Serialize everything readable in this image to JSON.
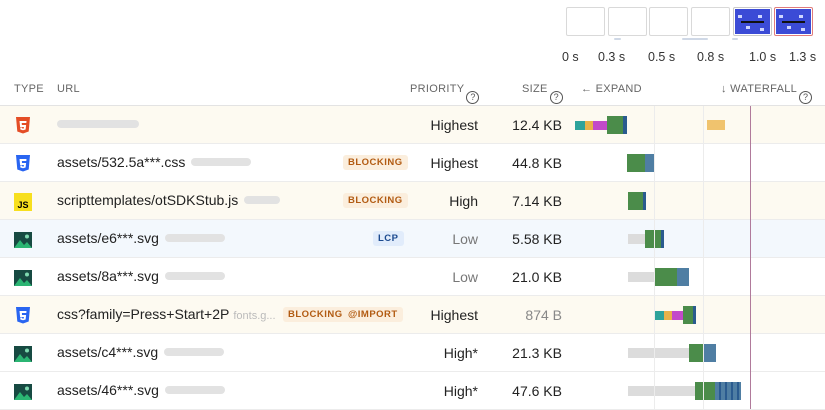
{
  "filmstrip": {
    "times": [
      "0 s",
      "0.3 s",
      "0.5 s",
      "0.8 s",
      "1.0 s",
      "1.3 s"
    ]
  },
  "header": {
    "type": "TYPE",
    "url": "URL",
    "priority": "PRIORITY",
    "size": "SIZE",
    "expand": "EXPAND",
    "waterfall": "WATERFALL"
  },
  "icons": {
    "html": "html5-icon",
    "css": "css3-icon",
    "js": "javascript-icon",
    "image": "image-icon"
  },
  "colors": {
    "html": "#e44d26",
    "css": "#2965f1",
    "js": "#f7df1e",
    "download": "#4b8c4a",
    "wait": "#dcdcdc",
    "blocking_badge": "#b25b12",
    "lcp_badge": "#1b4a8f",
    "marker_line": "#b07a9b"
  },
  "rows": [
    {
      "type": "html",
      "url": "",
      "host": "",
      "badges": [],
      "priority": "Highest",
      "size": "12.4 KB"
    },
    {
      "type": "css",
      "url": "assets/532.5a***.css",
      "host": "",
      "badges": [
        "BLOCKING"
      ],
      "priority": "Highest",
      "size": "44.8 KB"
    },
    {
      "type": "js",
      "url": "scripttemplates/otSDKStub.js",
      "host": "",
      "badges": [
        "BLOCKING"
      ],
      "priority": "High",
      "size": "7.14 KB"
    },
    {
      "type": "image",
      "url": "assets/e6***.svg",
      "host": "",
      "badges": [
        "LCP"
      ],
      "priority": "Low",
      "size": "5.58 KB"
    },
    {
      "type": "image",
      "url": "assets/8a***.svg",
      "host": "",
      "badges": [],
      "priority": "Low",
      "size": "21.0 KB"
    },
    {
      "type": "css",
      "url": "css?family=Press+Start+2P",
      "host": "fonts.g...",
      "badges": [
        "BLOCKING",
        "@IMPORT"
      ],
      "priority": "Highest",
      "size": "874 B"
    },
    {
      "type": "image",
      "url": "assets/c4***.svg",
      "host": "",
      "badges": [],
      "priority": "High*",
      "size": "21.3 KB"
    },
    {
      "type": "image",
      "url": "assets/46***.svg",
      "host": "",
      "badges": [],
      "priority": "High*",
      "size": "47.6 KB"
    }
  ]
}
